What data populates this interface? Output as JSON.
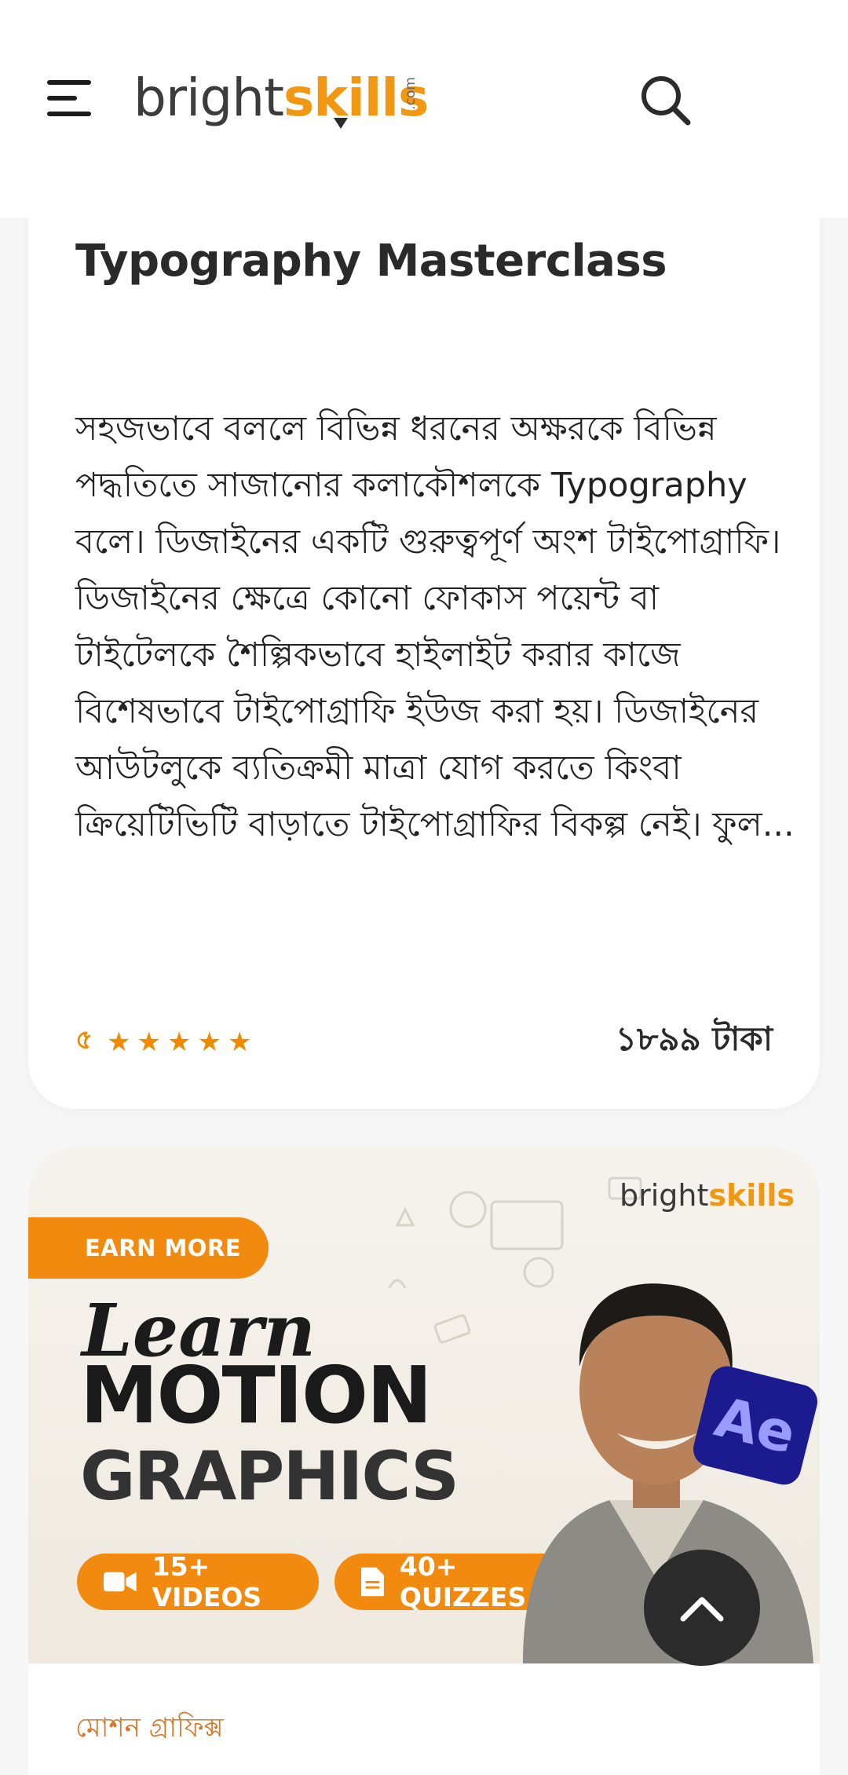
{
  "header": {
    "logo_bright": "bright",
    "logo_skills": "skills",
    "logo_com": ".com",
    "menu_icon": "hamburger-menu-icon",
    "search_icon": "search-icon"
  },
  "course1": {
    "title": "Typography Masterclass",
    "description": "সহজভাবে বললে বিভিন্ন ধরনের অক্ষরকে বিভিন্ন পদ্ধতিতে সাজানোর কলাকৌশলকে Typography বলে। ডিজাইনের একটি গুরুত্বপূর্ণ অংশ টাইপোগ্রাফি। ডিজাইনের ক্ষেত্রে কোনো ফোকাস পয়েন্ট বা টাইটেলকে শৈল্পিকভাবে হাইলাইট করার কাজে বিশেষভাবে টাইপোগ্রাফি ইউজ করা হয়। ডিজাইনের আউটলুকে ব্যতিক্রমী মাত্রা যোগ করতে কিংবা ক্রিয়েটিভিটি বাড়াতে টাইপোগ্রাফির বিকল্প নেই। ফুল...",
    "rating": "৫",
    "rating_value": 5,
    "price": "১৮৯৯ টাকা"
  },
  "course2": {
    "banner": {
      "logo_bright": "bright",
      "logo_skills": "skills",
      "earn_more": "EARN MORE",
      "learn": "Learn",
      "motion": "MOTION",
      "graphics": "GRAPHICS",
      "videos": "15+ VIDEOS",
      "quizzes": "40+ QUIZZES",
      "ae_badge": "Ae"
    },
    "category": "মোশন গ্রাফিক্স"
  },
  "colors": {
    "accent": "#f19712",
    "star": "#f08a00",
    "dark": "#2b2b2b"
  }
}
